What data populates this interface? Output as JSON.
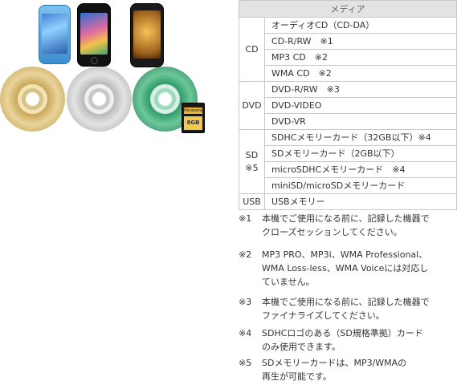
{
  "table": {
    "header": "メディア",
    "groups": [
      {
        "category": "CD",
        "rows": [
          "オーディオCD（CD-DA）",
          "CD-R/RW　※1",
          "MP3 CD　※2",
          "WMA CD　※2"
        ]
      },
      {
        "category": "DVD",
        "rows": [
          "DVD-R/RW　※3",
          "DVD-VIDEO",
          "DVD-VR"
        ]
      },
      {
        "category": "SD\n※5",
        "rows": [
          "SDHCメモリーカード（32GB以下）※4",
          "SDメモリーカード（2GB以下）",
          "microSDHCメモリーカード　※4",
          "miniSD/microSDメモリーカード"
        ]
      },
      {
        "category": "USB",
        "rows": [
          "USBメモリー"
        ]
      }
    ]
  },
  "notes": [
    {
      "mark": "※1",
      "lines": [
        "本機でご使用になる前に、記録した機器で",
        "クローズセッションしてください。"
      ]
    },
    {
      "mark": "※2",
      "lines": [
        "MP3 PRO、MP3i、WMA Professional、",
        "WMA Loss-less、WMA Voiceには対応し",
        "ていません。"
      ]
    },
    {
      "mark": "※3",
      "lines": [
        "本機でご使用になる前に、記録した機器で",
        "ファイナライズしてください。"
      ]
    },
    {
      "mark": "※4",
      "lines": [
        "SDHCロゴのある（SD規格準拠）カード",
        "のみ使用できます。"
      ]
    },
    {
      "mark": "※5",
      "lines": [
        "SDメモリーカードは、MP3/WMAの",
        "再生が可能です。"
      ]
    }
  ],
  "visual": {
    "sd_card_brand": "Panasonic",
    "sd_card_capacity": "8GB",
    "colors": {
      "gold_disc": "#c9a75a",
      "silver_disc": "#b9b9b9",
      "green_disc": "#2f9a6a",
      "blue_player": "#5aa8e0",
      "black_phone": "#111111"
    }
  }
}
